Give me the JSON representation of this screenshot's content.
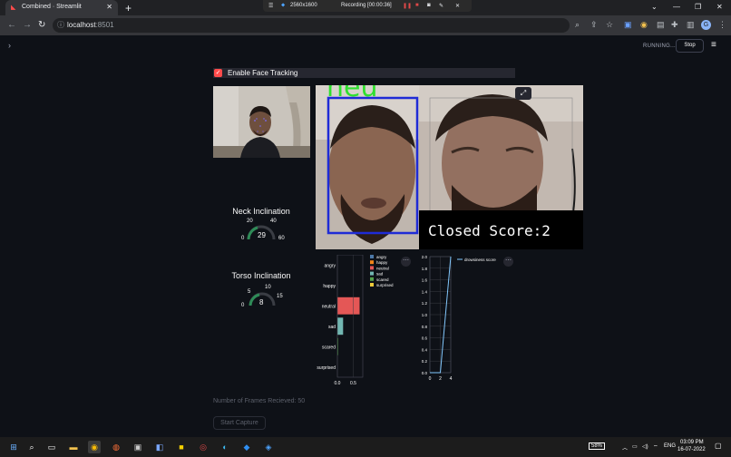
{
  "browser": {
    "tab_title": "Combined · Streamlit",
    "tab_close": "✕",
    "new_tab": "+",
    "url_host": "localhost",
    "url_port": ":8501",
    "recording": {
      "resolution": "2560x1600",
      "label": "Recording [00:00:36]"
    }
  },
  "app": {
    "status": "RUNNING...",
    "stop_label": "Stop",
    "face_tracking_label": "Enable Face Tracking",
    "face_tracking_checked": true,
    "overlay_text": "Closed  Score:2",
    "overlay_top_text": "neu",
    "neck": {
      "title": "Neck Inclination",
      "value": "29",
      "ticks": [
        "0",
        "20",
        "40",
        "60"
      ]
    },
    "torso": {
      "title": "Torso Inclination",
      "value": "8",
      "ticks": [
        "0",
        "5",
        "10",
        "15"
      ]
    },
    "frames_text": "Number of Frames Recieved: 50",
    "start_capture_label": "Start Capture"
  },
  "chart_data": [
    {
      "type": "bar",
      "orientation": "horizontal",
      "categories": [
        "angry",
        "happy",
        "neutral",
        "sad",
        "scared",
        "surprised"
      ],
      "values": [
        0.0,
        0.0,
        0.7,
        0.18,
        0.02,
        0.0
      ],
      "colors": [
        "#4c78a8",
        "#f58518",
        "#e45756",
        "#72b7b2",
        "#54a24b",
        "#eeca3b"
      ],
      "xlim": [
        0,
        0.8
      ],
      "xticks": [
        "0.0",
        "0.5"
      ],
      "legend": [
        "angry",
        "happy",
        "neutral",
        "sad",
        "scared",
        "surprised"
      ]
    },
    {
      "type": "line",
      "series": [
        {
          "name": "drowsiness score",
          "x": [
            0,
            1,
            2,
            3,
            4
          ],
          "y": [
            0,
            0,
            0,
            1,
            2
          ],
          "color": "#83c9ff"
        }
      ],
      "xlim": [
        0,
        4
      ],
      "ylim": [
        0,
        2
      ],
      "xticks": [
        "0",
        "2",
        "4"
      ],
      "yticks": [
        "0.0",
        "0.2",
        "0.4",
        "0.6",
        "0.8",
        "1.0",
        "1.2",
        "1.4",
        "1.6",
        "1.8",
        "2.0"
      ]
    }
  ],
  "taskbar": {
    "battery": "58%",
    "lang": "ENG",
    "time": "03:09 PM",
    "date": "16-07-2022"
  }
}
